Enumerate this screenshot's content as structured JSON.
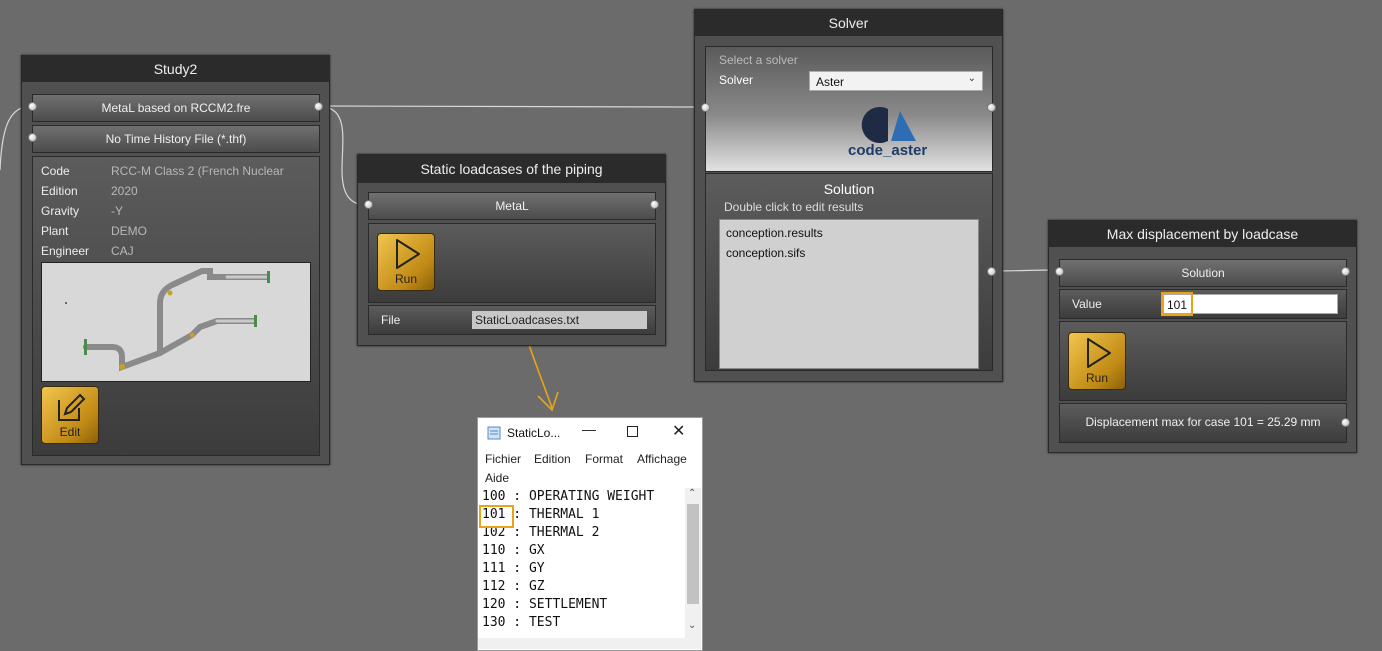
{
  "study": {
    "title": "Study2",
    "model_port": "MetaL based on RCCM2.fre",
    "thf_port": "No Time History File (*.thf)",
    "fields": [
      {
        "label": "Code",
        "value": "RCC-M Class 2 (French Nuclear"
      },
      {
        "label": "Edition",
        "value": "2020"
      },
      {
        "label": "Gravity",
        "value": "-Y"
      },
      {
        "label": "Plant",
        "value": "DEMO"
      },
      {
        "label": "Engineer",
        "value": "CAJ"
      }
    ],
    "edit_label": "Edit"
  },
  "static_loadcases": {
    "title": "Static loadcases of the piping",
    "port": "MetaL",
    "run_label": "Run",
    "file_label": "File",
    "file_value": "StaticLoadcases.txt"
  },
  "solver": {
    "title": "Solver",
    "hint": "Select a solver",
    "solver_label": "Solver",
    "solver_value": "Aster",
    "logo_text": "code_aster",
    "solution_title": "Solution",
    "solution_hint": "Double click to edit results",
    "results": [
      "conception.results",
      "conception.sifs"
    ]
  },
  "max_disp": {
    "title": "Max displacement by loadcase",
    "port": "Solution",
    "value_label": "Value",
    "value": "101",
    "run_label": "Run",
    "output": "Displacement max for case 101 = 25.29 mm"
  },
  "notepad": {
    "title": "StaticLo...",
    "menu": [
      "Fichier",
      "Edition",
      "Format",
      "Affichage",
      "Aide"
    ],
    "lines": [
      "100 : OPERATING WEIGHT",
      "101 : THERMAL 1",
      "102 : THERMAL 2",
      "110 : GX",
      "111 : GY",
      "112 : GZ",
      "120 : SETTLEMENT",
      "130 : TEST"
    ]
  },
  "colors": {
    "canvas": "#6b6b6b",
    "accent_gold": "#e8a417",
    "logo_navy": "#1f2a44",
    "logo_blue": "#2e6db4"
  }
}
